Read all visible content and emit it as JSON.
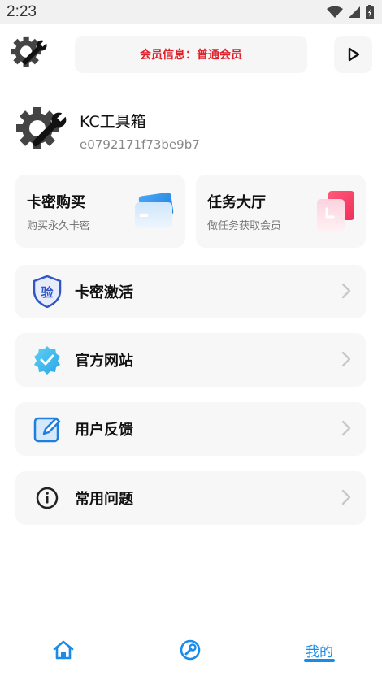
{
  "status_bar": {
    "time": "2:23",
    "icons": [
      "wifi-icon",
      "signal-icon",
      "battery-icon"
    ]
  },
  "header": {
    "logo_icon": "gear-wrench-icon",
    "member_info": "会员信息：普通会员",
    "play_icon": "play-icon"
  },
  "profile": {
    "name": "KC工具箱",
    "id": "e0792171f73be9b7"
  },
  "cards": [
    {
      "title": "卡密购买",
      "subtitle": "购买永久卡密",
      "icon": "card-icon"
    },
    {
      "title": "任务大厅",
      "subtitle": "做任务获取会员",
      "icon": "task-icon"
    }
  ],
  "menu": [
    {
      "label": "卡密激活",
      "icon": "verify-shield-icon"
    },
    {
      "label": "官方网站",
      "icon": "verified-badge-icon"
    },
    {
      "label": "用户反馈",
      "icon": "edit-icon"
    },
    {
      "label": "常用问题",
      "icon": "info-icon"
    }
  ],
  "tabbar": {
    "tabs": [
      {
        "name": "home",
        "icon": "home-icon"
      },
      {
        "name": "tools",
        "icon": "wrench-icon"
      },
      {
        "name": "mine",
        "label": "我的"
      }
    ],
    "active": "mine"
  },
  "colors": {
    "accent": "#1a8be8",
    "member_red": "#e0202a",
    "card_bg": "#f7f7f7"
  }
}
